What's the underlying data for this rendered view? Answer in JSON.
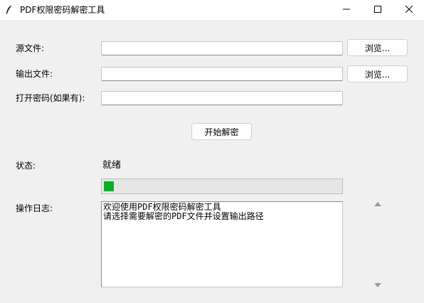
{
  "window": {
    "title": "PDF权限密码解密工具",
    "controls": {
      "minimize": "minimize",
      "maximize": "maximize",
      "close": "close"
    }
  },
  "form": {
    "source_label": "源文件:",
    "source_value": "",
    "output_label": "输出文件:",
    "output_value": "",
    "password_label": "打开密码(如果有):",
    "password_value": "",
    "browse_label": "浏览..."
  },
  "actions": {
    "start_label": "开始解密"
  },
  "status": {
    "label": "状态:",
    "value": "就绪",
    "progress": 0.04,
    "progress_color": "#06b025"
  },
  "log": {
    "label": "操作日志:",
    "lines": [
      "欢迎使用PDF权限密码解密工具",
      "请选择需要解密的PDF文件并设置输出路径"
    ]
  },
  "icons": {
    "app": "feather-icon",
    "scroll_up": "scroll-up-arrow-icon",
    "scroll_down": "scroll-down-arrow-icon"
  }
}
